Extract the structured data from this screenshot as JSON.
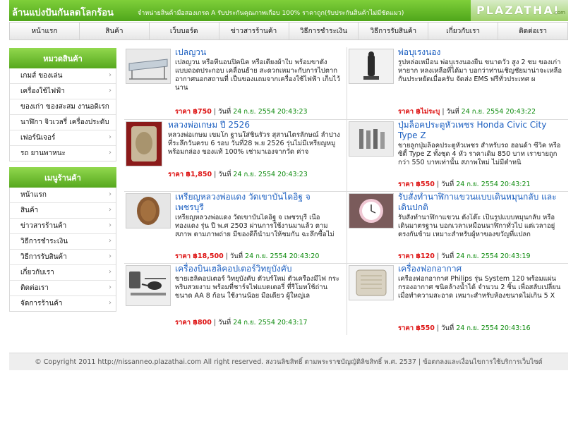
{
  "header": {
    "title": "ล้านแบ่งปันกันลดโลกร้อน",
    "subtitle": "จำหน่ายสินค้ามือสองเกรด A รับประกันคุณภาพเกือบ 100% ราคาถูก(รับประกันสินค้าไม่มีชัดแมว)",
    "logo": "PLAZATHAI",
    "logo_com": ".com"
  },
  "nav": [
    "หน้าแรก",
    "สินค้า",
    "เว็บบอร์ด",
    "ข่าวสารร้านค้า",
    "วิธีการชำระเงิน",
    "วิธีการรับสินค้า",
    "เกี่ยวกับเรา",
    "ติดต่อเรา"
  ],
  "sidebar": {
    "categories_title": "หมวดสินค้า",
    "categories": [
      "เกมส์ ของเล่น",
      "เครื่องใช้ไฟฟ้า",
      "ของเก่า ของสะสม งานอดิเรก",
      "นาฬิกา จิวเวลรี่ เครื่องประดับ",
      "เฟอร์นิเจอร์",
      "รถ ยานพาหนะ"
    ],
    "menu_title": "เมนูร้านค้า",
    "menu": [
      "หน้าแรก",
      "สินค้า",
      "ข่าวสารร้านค้า",
      "วิธีการชำระเงิน",
      "วิธีการรับสินค้า",
      "เกี่ยวกับเรา",
      "ติดต่อเรา",
      "จัดการร้านค้า"
    ]
  },
  "products": [
    {
      "title": "เปลญวน",
      "desc": "เปลญวน หรือที่นอนปิคนิค หรือเตียงผ้าใบ พร้อมขาตั้ง แบบถอดประกอบ เคลื่อนย้าย สะดวกเหมาะกับการไปตากอากาศนอกสถานที่ เป็นของแถมจากเครื่องใช้ไฟฟ้า เก็บไว้นาน",
      "price": "ราคา ฿750",
      "date_label": "วันที่",
      "date": "24 ก.ย. 2554 20:43:23",
      "icon": "hammock-image"
    },
    {
      "title": "พ่อบุเรงนอง",
      "desc": "รูปหล่อเหมือน พ่อบุเรงนองยืน ขนาดวัว สูง 2 ซม ของเก่าหายาก หลงเหลือที่ได้มา บอกว่าท่านเชิญชัยมาน่าจะเหลือกันประหยัดเมื่อครับ จัดส่ง EMS ฟรีทั่วประเทศ ผ",
      "price": "ราคา ฿ไม่ระบุ",
      "date_label": "วันที่",
      "date": "24 ก.ย. 2554 20:43:22",
      "icon": "statue-image"
    },
    {
      "title": "หลวงพ่อเกษม ปี 2526",
      "desc": "หลวงพ่อเกษม เขมโก ฐานใส่ชิ้นรัวร สุสานไตรลักษณ์ ลำปาง ที่ระลึกวันครบ 6 รอบ วันที่28 พ.ย 2526 รุ่นไม่มีเหรียญหมู พร้อมกล่อง ของแท้ 100% เช่ามาเองจากวัด ค่าจ",
      "price": "ราคา ฿1,850",
      "date_label": "วันที่",
      "date": "24 ก.ย. 2554 20:43:23",
      "icon": "amulet-image"
    },
    {
      "title": "ปุ่มล็อคประตูหัวเพชร Honda Civic City Type Z",
      "desc": "ขายลูกปุ่มล็อคประตูหัวเพชร สำหรับรถ ฮอนด้า ซีวิค หรือ ซิตี้ Type Z ทั้งชุด 4 หัว ราคาเดิม 850 บาท เราขายถูกกว่า 550 บาทเท่านั้น สภาพใหม่ ไม่มีตำหนิ",
      "price": "ราคา ฿550",
      "date_label": "วันที่",
      "date": "24 ก.ย. 2554 20:43:21",
      "icon": "door-lock-image"
    },
    {
      "title": "เหรียญหลวงพ่อแดง วัดเขาบันไดอิฐ จ เพชรบุรี",
      "desc": "เหรียญหลวงพ่อแดง วัดเขาบันไดอิฐ จ เพชรบุรี เนื้อทองแดง รุ่น ปี พ.ศ 2503 ผ่านการใช้งานมาแล้ว ตามสภาพ ตามภาพถ่าย มีของดีก็นำมาให้ชมกัน ฉะลึกซื้อไม่ผิดหวัง",
      "price": "ราคา ฿18,500",
      "date_label": "วันที่",
      "date": "24 ก.ย. 2554 20:43:20",
      "icon": "coin-image"
    },
    {
      "title": "รับสั่งทำนาฬิกาแขวนแบบเดินหมุนกลับ และเดินปกติ",
      "desc": "รับสั่งทำนาฬิกาแขวน ตั้งโต๊ะ เป็นรูปแบบหมุนกลับ หรือเดินมาตรฐาน บอกเวลาเหมือนนาฬิกาทั่วไป แต่เวลาอยู่ตรงกันข้าม เหมาะสำหรับผู้หาของขวัญที่แปลก",
      "price": "ราคา ฿120",
      "date_label": "วันที่",
      "date": "24 ก.ย. 2554 20:43:19",
      "icon": "clock-image"
    },
    {
      "title": "เครื่องบินเฮลิคอปเตอร์วิทยุบังคับ",
      "desc": "ขายเฮลิคอปเตอร์ วิทยุบังคับ ตัวบร์ใหม่ ตัวเครื่องมีไฟ กระพริบสวยงาม พร้อมที่ชาร์จไฟแบตเตอรี่ ที่รีโมทใช้ถ่านขนาด AA 8 ก้อน ใช้งานน้อย มือเดียว ผู้ใหญ่เล",
      "price": "ราคา ฿800",
      "date_label": "วันที่",
      "date": "24 ก.ย. 2554 20:43:17",
      "icon": "helicopter-image"
    },
    {
      "title": "เครื่องฟอกอากาศ",
      "desc": "เครื่องฟอกอากาศ Philips รุ่น System 120 พร้อมแผ่นกรองอากาศ ชนิดล้างน้ำได้ จำนวน 2 ชิ้น เพื่อสลับเปลี่ยนเมื่อทำความสะอาด เหมาะสำหรับห้องขนาดไม่เกิน 5 X",
      "price": "ราคา ฿550",
      "date_label": "วันที่",
      "date": "24 ก.ย. 2554 20:43:16",
      "icon": "air-purifier-image"
    }
  ],
  "footer": {
    "text": "© Copyright 2011 http://nissanneo.plazathai.com All right reserved. สงวนลิขสิทธิ์ ตามพระราชบัญญัติลิขสิทธิ์ พ.ศ. 2537  |  ข้อตกลงและเงื่อนไขการใช้บริการเว็บไซต์"
  },
  "colors": {
    "header_green": "#5aaf22",
    "link_blue": "#1c5fc0",
    "price_red": "#dd1111",
    "date_green": "#0b8a0b"
  }
}
